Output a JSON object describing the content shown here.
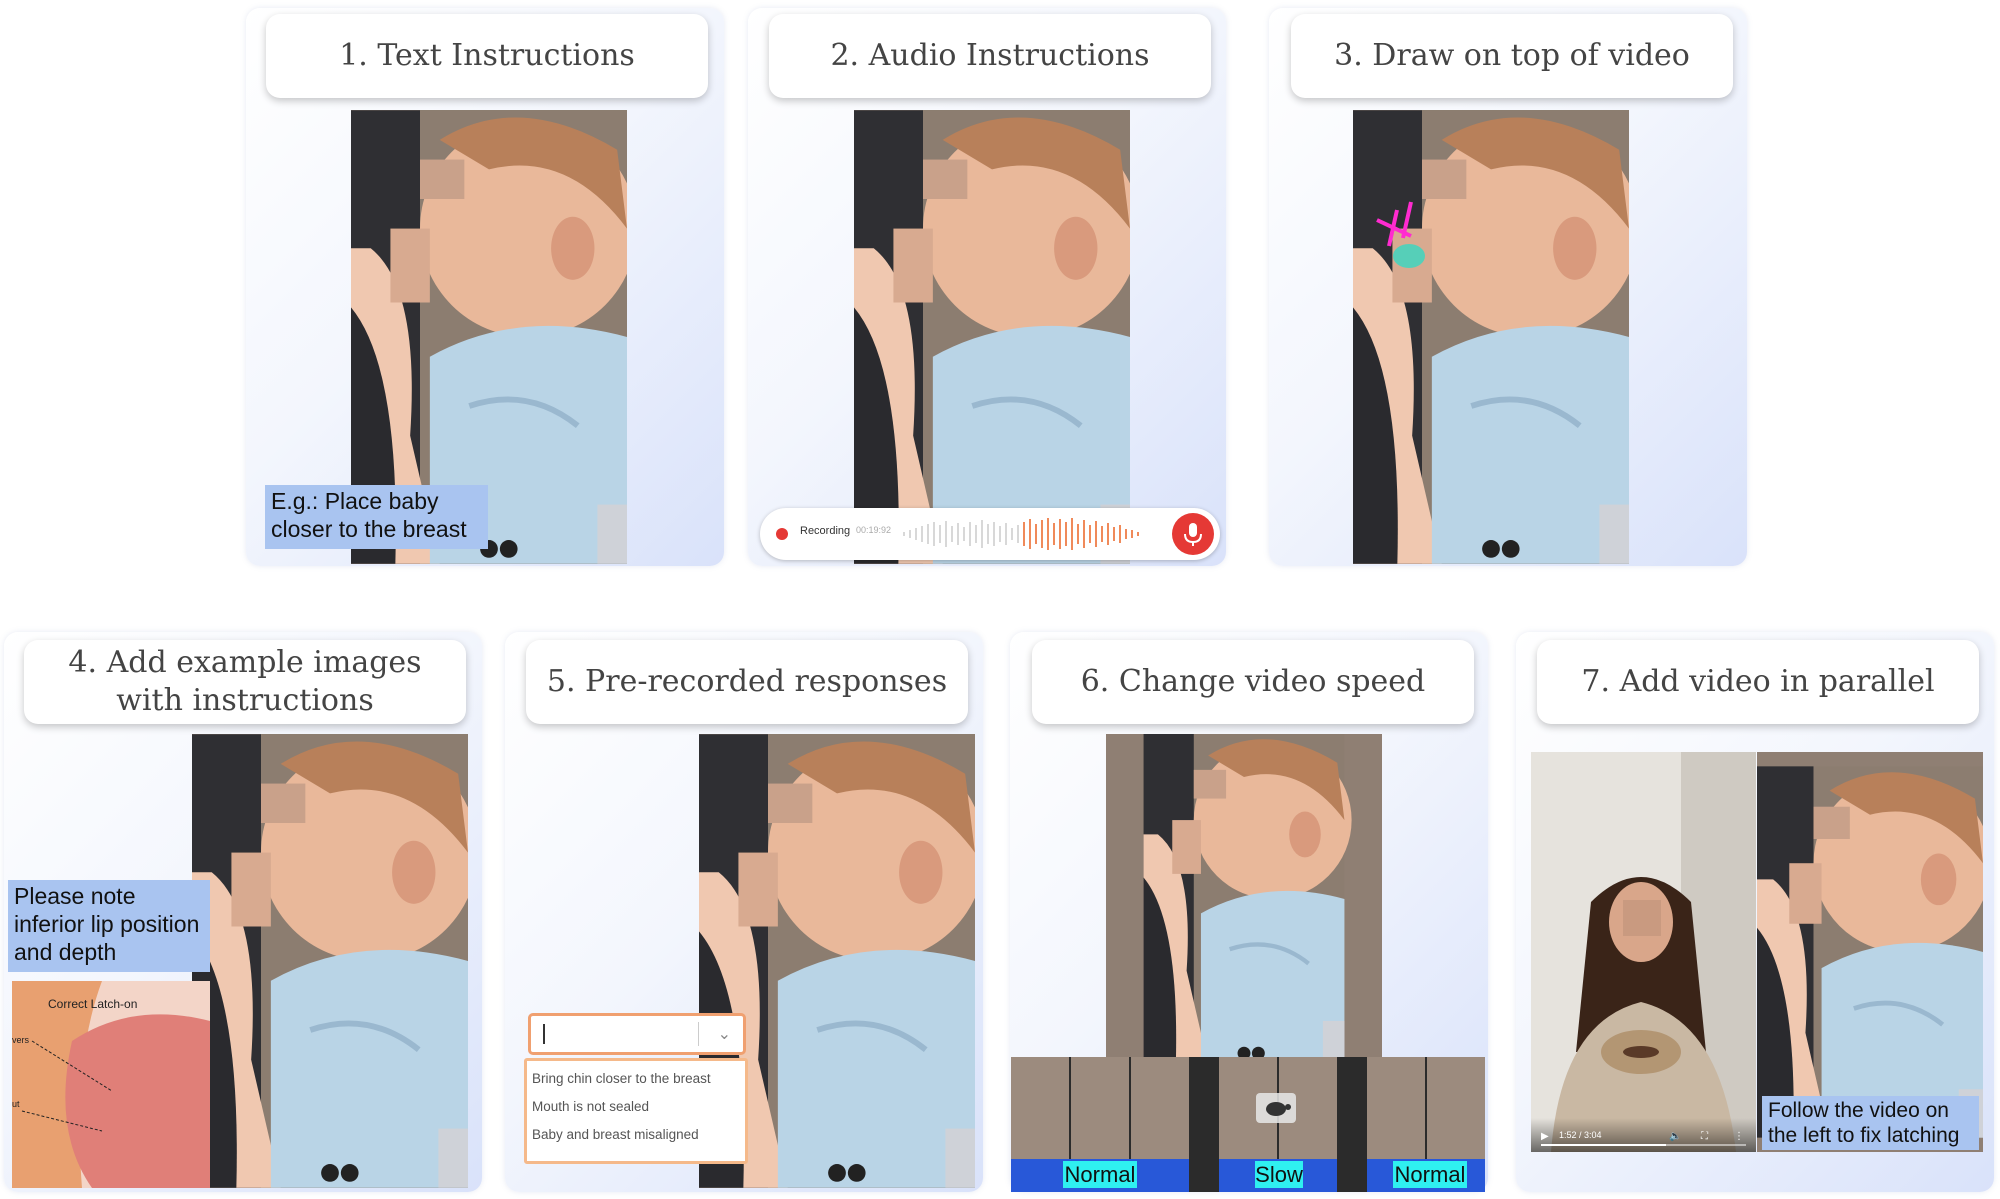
{
  "panels": [
    {
      "title": "1. Text Instructions"
    },
    {
      "title": "2. Audio Instructions"
    },
    {
      "title": "3. Draw on top of video"
    },
    {
      "title": "4. Add example images with instructions"
    },
    {
      "title": "5. Pre-recorded responses"
    },
    {
      "title": "6. Change video speed"
    },
    {
      "title": "7. Add video in parallel"
    }
  ],
  "text_instruction": {
    "line1": "E.g.: Place baby",
    "line2": "closer to the breast"
  },
  "recording": {
    "label": "Recording",
    "time": "00:19:92"
  },
  "example_image": {
    "note_line1": "Please note",
    "note_line2": "inferior lip position",
    "note_line3": "and depth",
    "diagram_title": "Correct Latch-on",
    "side_label_1": "vers",
    "side_label_2": "ut"
  },
  "prerecorded": {
    "options": [
      "Bring chin closer to the breast",
      "Mouth is not sealed",
      "Baby and breast misaligned"
    ]
  },
  "speed": {
    "labels": [
      "Normal",
      "Slow",
      "Normal"
    ]
  },
  "parallel": {
    "player_time": "1:52 / 3:04",
    "progress": 0.61,
    "caption_line1": "Follow the video on",
    "caption_line2": "the left to fix latching"
  },
  "colors": {
    "caption_bg": "#a9c4f0",
    "record_red": "#e53935",
    "speed_band": "#2858d8",
    "speed_label": "#2ff0f0",
    "dropdown_border": "#f0a070"
  }
}
